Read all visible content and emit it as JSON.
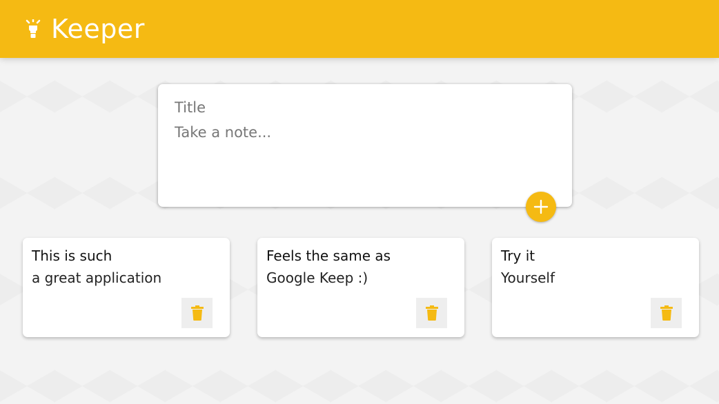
{
  "header": {
    "title": "Keeper",
    "logo_icon": "lightbulb-icon",
    "color": "#f5ba13"
  },
  "compose": {
    "title_placeholder": "Title",
    "content_placeholder": "Take a note...",
    "add_icon": "plus-icon"
  },
  "notes": [
    {
      "title": "This is such",
      "content": "a great application",
      "delete_icon": "trash-icon"
    },
    {
      "title": "Feels the same as",
      "content": "Google Keep :)",
      "delete_icon": "trash-icon"
    },
    {
      "title": "Try it",
      "content": "Yourself",
      "delete_icon": "trash-icon"
    }
  ]
}
